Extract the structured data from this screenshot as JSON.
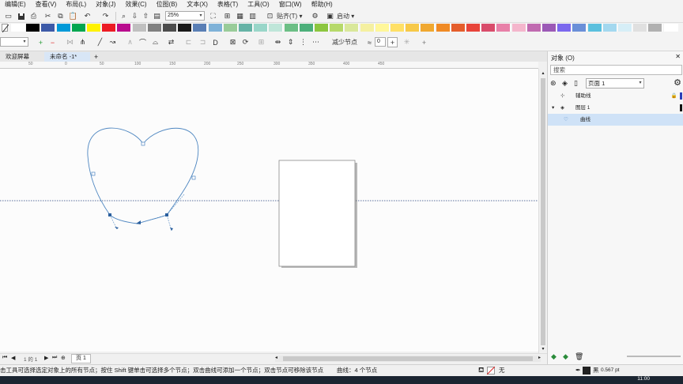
{
  "menu": [
    "编辑(E)",
    "查看(V)",
    "布局(L)",
    "对象(J)",
    "效果(C)",
    "位图(B)",
    "文本(X)",
    "表格(T)",
    "工具(O)",
    "窗口(W)",
    "帮助(H)"
  ],
  "toolbar": {
    "zoom_value": "25%",
    "snap_label": "贴齐(T)",
    "launch_label": "启动"
  },
  "palette": [
    "#ffffff",
    "#000000",
    "#3d5aa8",
    "#0099d8",
    "#00a650",
    "#fff200",
    "#ec1c24",
    "#b90c8e",
    "#c0c0c0",
    "#808080",
    "#4d4d4d",
    "#1a1a1a",
    "#5a7fb5",
    "#7fb2d8",
    "#99cc99",
    "#66b3a6",
    "#99d6c9",
    "#bfe6d9",
    "#6cbf85",
    "#4caf7a",
    "#8cc63f",
    "#b6d96a",
    "#d9e89a",
    "#f5f0a0",
    "#fff799",
    "#ffe066",
    "#f7c948",
    "#f0a830",
    "#f08a24",
    "#e55d2b",
    "#e8443a",
    "#d94c6b",
    "#e880a8",
    "#f4b6cc",
    "#c06ab0",
    "#9b59b6",
    "#7b68ee",
    "#6a8fd8",
    "#5bc0de",
    "#a3d8ef",
    "#d6eef7",
    "#e0e0e0",
    "#b0b0b0",
    "#ffffff"
  ],
  "propbar": {
    "reduce_nodes_label": "减少节点",
    "reduce_value": "0"
  },
  "tabs": [
    {
      "label": "欢迎屏幕"
    },
    {
      "label": "未命名 -1*"
    }
  ],
  "ruler_top": [
    "50",
    "0",
    "50",
    "100",
    "150",
    "200",
    "250",
    "300",
    "350",
    "400",
    "450"
  ],
  "page_tab": "页 1",
  "page_nav": "1 的 1",
  "status": {
    "hint": "击工具可选择选定对象上的所有节点；按住 Shift 键单击可选择多个节点；双击曲线可添加一个节点；双击节点可移除该节点",
    "object_info": "曲线：4 个节点",
    "fill_label": "无",
    "outline_label": "黑",
    "outline_width": "0.567 pt"
  },
  "clock": "11:00",
  "objects_panel": {
    "title": "对象 (O)",
    "search_placeholder": "搜索",
    "page_select": "页面 1",
    "rows": [
      {
        "label": "辅助线"
      },
      {
        "label": "图层 1"
      },
      {
        "label": "曲线"
      }
    ]
  },
  "colors": {
    "curve": "#4f87c1",
    "guide": "#5b6f9e",
    "selection": "#cfe2f7",
    "taskbar": "#1b2531"
  }
}
